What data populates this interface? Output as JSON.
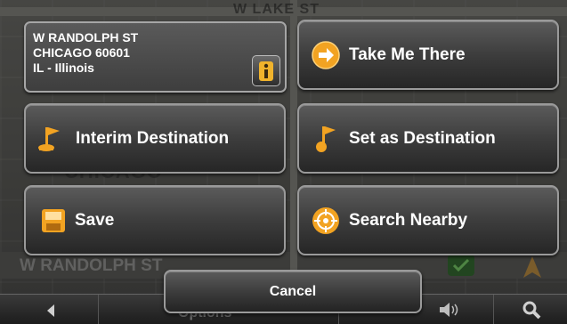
{
  "address": {
    "line1": "W RANDOLPH ST",
    "line2": "CHICAGO 60601",
    "line3": "IL - Illinois"
  },
  "actions": {
    "take_me_there": "Take Me There",
    "interim_destination": "Interim Destination",
    "set_as_destination": "Set as Destination",
    "save": "Save",
    "search_nearby": "Search Nearby",
    "cancel": "Cancel"
  },
  "map": {
    "top_street": "W LAKE ST",
    "city_label": "CHICAGO",
    "current_street": "W RANDOLPH ST"
  },
  "bottom_bar": {
    "options_label": "Options"
  },
  "colors": {
    "accent_orange": "#f5a623",
    "button_border": "#9a9a9a",
    "check_green": "#3aa535"
  },
  "icons": {
    "take_me_there": "arrow-right-circle-icon",
    "interim_destination": "flag-icon",
    "set_as_destination": "flag-icon",
    "save": "floppy-icon",
    "search_nearby": "target-icon",
    "info": "info-icon"
  }
}
